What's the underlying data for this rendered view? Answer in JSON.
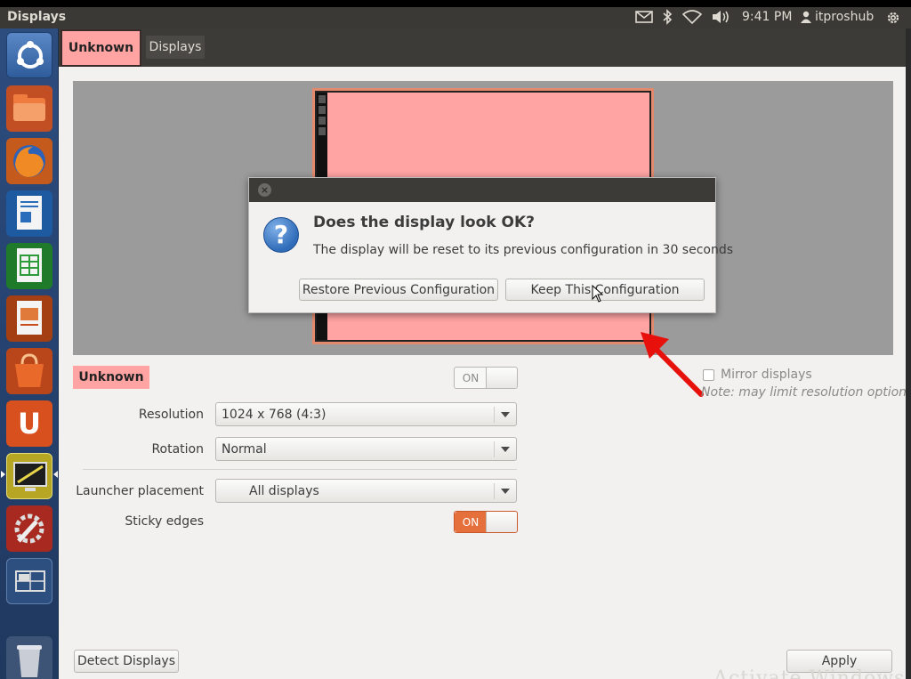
{
  "top_panel": {
    "app_title": "Displays",
    "clock": "9:41 PM",
    "user": "itproshub"
  },
  "launcher": {
    "items": [
      {
        "name": "dash-icon",
        "color": "#3d6fb4"
      },
      {
        "name": "files-icon",
        "color": "#e0632f"
      },
      {
        "name": "firefox-icon",
        "color": "#e66a20"
      },
      {
        "name": "writer-icon",
        "color": "#2a6ebb"
      },
      {
        "name": "calc-icon",
        "color": "#2e9b3a"
      },
      {
        "name": "impress-icon",
        "color": "#c94d1a"
      },
      {
        "name": "software-center-icon",
        "color": "#dd5a1f"
      },
      {
        "name": "ubuntu-one-icon",
        "color": "#d9501f"
      },
      {
        "name": "displays-icon",
        "color": "#d7c43a"
      },
      {
        "name": "system-settings-icon",
        "color": "#c5372c"
      },
      {
        "name": "workspace-switcher-icon",
        "color": "#3b5f91"
      },
      {
        "name": "trash-icon",
        "color": "#7b8799"
      }
    ],
    "ubuntu_one_letter": "U"
  },
  "toolbar": {
    "tab_unknown": "Unknown",
    "tab_displays": "Displays"
  },
  "dialog": {
    "icon_glyph": "?",
    "close_glyph": "×",
    "heading": "Does the display look OK?",
    "message": "The display will be reset to its previous configuration in 30 seconds",
    "restore_button": "Restore Previous Configuration",
    "keep_button": "Keep This Configuration"
  },
  "settings": {
    "display_name": "Unknown",
    "display_switch": "ON",
    "resolution_label": "Resolution",
    "resolution_value": "1024 x 768 (4:3)",
    "rotation_label": "Rotation",
    "rotation_value": "Normal",
    "launcher_label": "Launcher placement",
    "launcher_value": "All displays",
    "sticky_label": "Sticky edges",
    "sticky_switch": "ON",
    "mirror_label": "Mirror displays",
    "mirror_note": "Note: may limit resolution options"
  },
  "footer": {
    "detect_button": "Detect Displays",
    "apply_button": "Apply"
  },
  "watermark": "Activate Windows",
  "colors": {
    "accent_orange": "#e5703c",
    "display_pink": "#ffa3a3",
    "panel_dark": "#3c3b37",
    "arrow_red": "#e8100b"
  }
}
